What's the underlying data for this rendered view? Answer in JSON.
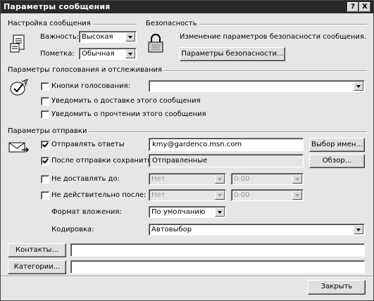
{
  "window": {
    "title": "Параметры сообщения",
    "help": "?",
    "close": "X"
  },
  "settings": {
    "group_title": "Настройка сообщения",
    "importance_label": "Важность:",
    "importance_value": "Высокая",
    "sensitivity_label": "Пометка:",
    "sensitivity_value": "Обычная"
  },
  "security": {
    "group_title": "Безопасность",
    "text": "Изменение параметров безопасности сообщения.",
    "button": "Параметры безопасности..."
  },
  "voting": {
    "group_title": "Параметры голосования и отслеживания",
    "buttons_label": "Кнопки голосования:",
    "buttons_value": "",
    "delivery_label": "Уведомить о доставке этого сообщения",
    "read_label": "Уведомить о прочтении этого сообщения"
  },
  "delivery": {
    "group_title": "Параметры отправки",
    "replies_label": "Отправлять ответы",
    "replies_value": "kmy@gardenco.msn.com",
    "select_names_button": "Выбор имен...",
    "save_label": "После отправки сохранить в:",
    "save_value": "Отправленные",
    "browse_button": "Обзор...",
    "no_delivery_label": "Не доставлять до:",
    "no_delivery_date": "Нет",
    "no_delivery_time": "0:00",
    "expires_label": "Не действительно после:",
    "expires_date": "Нет",
    "expires_time": "0:00",
    "format_label": "Формат вложения:",
    "format_value": "По умолчанию",
    "encoding_label": "Кодировка:",
    "encoding_value": "Автовыбор"
  },
  "contacts": {
    "button": "Контакты...",
    "value": ""
  },
  "categories": {
    "button": "Категории...",
    "value": ""
  },
  "footer": {
    "close_button": "Закрыть"
  },
  "checkboxes": {
    "voting_buttons": false,
    "delivery_receipt": false,
    "read_receipt": false,
    "have_replies": true,
    "save_sent": true,
    "do_not_deliver": false,
    "expires": false
  }
}
